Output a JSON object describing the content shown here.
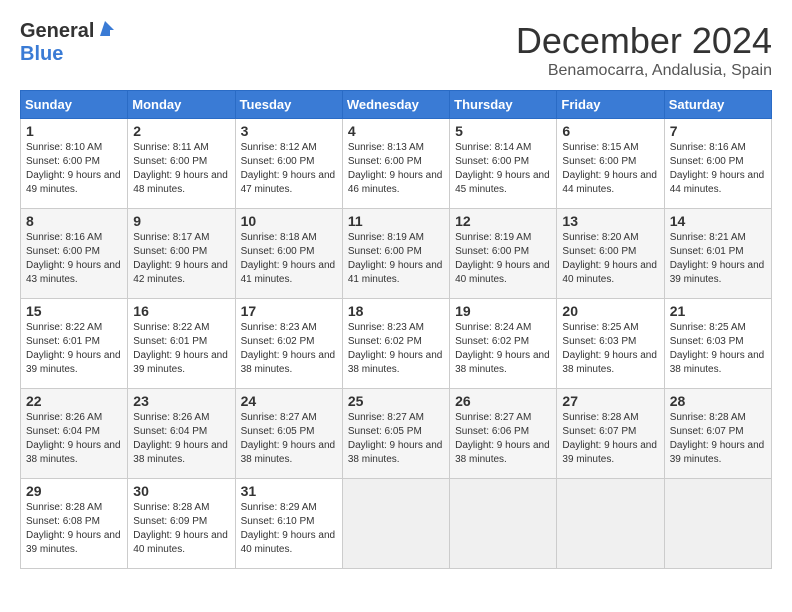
{
  "header": {
    "logo_general": "General",
    "logo_blue": "Blue",
    "title": "December 2024",
    "subtitle": "Benamocarra, Andalusia, Spain"
  },
  "days_of_week": [
    "Sunday",
    "Monday",
    "Tuesday",
    "Wednesday",
    "Thursday",
    "Friday",
    "Saturday"
  ],
  "weeks": [
    [
      {
        "day": "1",
        "sunrise": "8:10 AM",
        "sunset": "6:00 PM",
        "daylight_hours": "9 hours and 49 minutes."
      },
      {
        "day": "2",
        "sunrise": "8:11 AM",
        "sunset": "6:00 PM",
        "daylight_hours": "9 hours and 48 minutes."
      },
      {
        "day": "3",
        "sunrise": "8:12 AM",
        "sunset": "6:00 PM",
        "daylight_hours": "9 hours and 47 minutes."
      },
      {
        "day": "4",
        "sunrise": "8:13 AM",
        "sunset": "6:00 PM",
        "daylight_hours": "9 hours and 46 minutes."
      },
      {
        "day": "5",
        "sunrise": "8:14 AM",
        "sunset": "6:00 PM",
        "daylight_hours": "9 hours and 45 minutes."
      },
      {
        "day": "6",
        "sunrise": "8:15 AM",
        "sunset": "6:00 PM",
        "daylight_hours": "9 hours and 44 minutes."
      },
      {
        "day": "7",
        "sunrise": "8:16 AM",
        "sunset": "6:00 PM",
        "daylight_hours": "9 hours and 44 minutes."
      }
    ],
    [
      {
        "day": "8",
        "sunrise": "8:16 AM",
        "sunset": "6:00 PM",
        "daylight_hours": "9 hours and 43 minutes."
      },
      {
        "day": "9",
        "sunrise": "8:17 AM",
        "sunset": "6:00 PM",
        "daylight_hours": "9 hours and 42 minutes."
      },
      {
        "day": "10",
        "sunrise": "8:18 AM",
        "sunset": "6:00 PM",
        "daylight_hours": "9 hours and 41 minutes."
      },
      {
        "day": "11",
        "sunrise": "8:19 AM",
        "sunset": "6:00 PM",
        "daylight_hours": "9 hours and 41 minutes."
      },
      {
        "day": "12",
        "sunrise": "8:19 AM",
        "sunset": "6:00 PM",
        "daylight_hours": "9 hours and 40 minutes."
      },
      {
        "day": "13",
        "sunrise": "8:20 AM",
        "sunset": "6:00 PM",
        "daylight_hours": "9 hours and 40 minutes."
      },
      {
        "day": "14",
        "sunrise": "8:21 AM",
        "sunset": "6:01 PM",
        "daylight_hours": "9 hours and 39 minutes."
      }
    ],
    [
      {
        "day": "15",
        "sunrise": "8:22 AM",
        "sunset": "6:01 PM",
        "daylight_hours": "9 hours and 39 minutes."
      },
      {
        "day": "16",
        "sunrise": "8:22 AM",
        "sunset": "6:01 PM",
        "daylight_hours": "9 hours and 39 minutes."
      },
      {
        "day": "17",
        "sunrise": "8:23 AM",
        "sunset": "6:02 PM",
        "daylight_hours": "9 hours and 38 minutes."
      },
      {
        "day": "18",
        "sunrise": "8:23 AM",
        "sunset": "6:02 PM",
        "daylight_hours": "9 hours and 38 minutes."
      },
      {
        "day": "19",
        "sunrise": "8:24 AM",
        "sunset": "6:02 PM",
        "daylight_hours": "9 hours and 38 minutes."
      },
      {
        "day": "20",
        "sunrise": "8:25 AM",
        "sunset": "6:03 PM",
        "daylight_hours": "9 hours and 38 minutes."
      },
      {
        "day": "21",
        "sunrise": "8:25 AM",
        "sunset": "6:03 PM",
        "daylight_hours": "9 hours and 38 minutes."
      }
    ],
    [
      {
        "day": "22",
        "sunrise": "8:26 AM",
        "sunset": "6:04 PM",
        "daylight_hours": "9 hours and 38 minutes."
      },
      {
        "day": "23",
        "sunrise": "8:26 AM",
        "sunset": "6:04 PM",
        "daylight_hours": "9 hours and 38 minutes."
      },
      {
        "day": "24",
        "sunrise": "8:27 AM",
        "sunset": "6:05 PM",
        "daylight_hours": "9 hours and 38 minutes."
      },
      {
        "day": "25",
        "sunrise": "8:27 AM",
        "sunset": "6:05 PM",
        "daylight_hours": "9 hours and 38 minutes."
      },
      {
        "day": "26",
        "sunrise": "8:27 AM",
        "sunset": "6:06 PM",
        "daylight_hours": "9 hours and 38 minutes."
      },
      {
        "day": "27",
        "sunrise": "8:28 AM",
        "sunset": "6:07 PM",
        "daylight_hours": "9 hours and 39 minutes."
      },
      {
        "day": "28",
        "sunrise": "8:28 AM",
        "sunset": "6:07 PM",
        "daylight_hours": "9 hours and 39 minutes."
      }
    ],
    [
      {
        "day": "29",
        "sunrise": "8:28 AM",
        "sunset": "6:08 PM",
        "daylight_hours": "9 hours and 39 minutes."
      },
      {
        "day": "30",
        "sunrise": "8:28 AM",
        "sunset": "6:09 PM",
        "daylight_hours": "9 hours and 40 minutes."
      },
      {
        "day": "31",
        "sunrise": "8:29 AM",
        "sunset": "6:10 PM",
        "daylight_hours": "9 hours and 40 minutes."
      },
      null,
      null,
      null,
      null
    ]
  ],
  "labels": {
    "sunrise": "Sunrise:",
    "sunset": "Sunset:",
    "daylight": "Daylight:"
  }
}
